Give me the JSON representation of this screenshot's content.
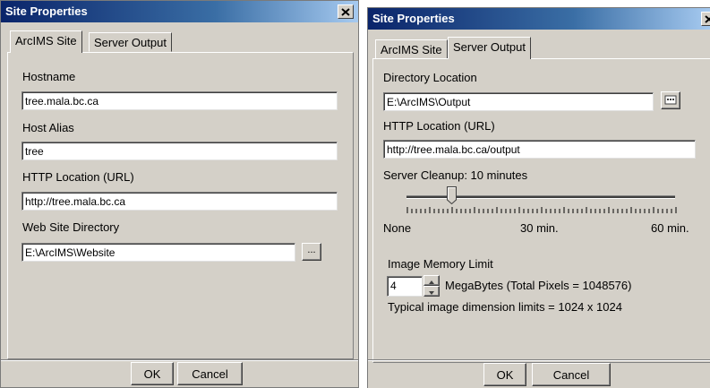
{
  "left_dialog": {
    "title": "Site Properties",
    "tabs": [
      {
        "label": "ArcIMS Site",
        "active": true
      },
      {
        "label": "Server Output",
        "active": false
      }
    ],
    "hostname_label": "Hostname",
    "hostname_value": "tree.mala.bc.ca",
    "host_alias_label": "Host Alias",
    "host_alias_value": "tree",
    "http_location_label": "HTTP Location (URL)",
    "http_location_value": "http://tree.mala.bc.ca",
    "web_dir_label": "Web Site Directory",
    "web_dir_value": "E:\\ArcIMS\\Website",
    "browse_label": "...",
    "ok_label": "OK",
    "cancel_label": "Cancel"
  },
  "right_dialog": {
    "title": "Site Properties",
    "tabs": [
      {
        "label": "ArcIMS Site",
        "active": false
      },
      {
        "label": "Server Output",
        "active": true
      }
    ],
    "dir_location_label": "Directory Location",
    "dir_location_value": "E:\\ArcIMS\\Output",
    "http_location_label": "HTTP Location (URL)",
    "http_location_value": "http://tree.mala.bc.ca/output",
    "cleanup_label": "Server Cleanup:  10 minutes",
    "cleanup_minutes": 10,
    "cleanup_max_minutes": 60,
    "slider_none": "None",
    "slider_mid": "30 min.",
    "slider_max": "60 min.",
    "memory_label": "Image Memory Limit",
    "memory_value": "4",
    "memory_unit": "MegaBytes  (Total Pixels = 1048576)",
    "dimension_text": "Typical image dimension limits = 1024 x 1024",
    "ok_label": "OK",
    "cancel_label": "Cancel"
  }
}
